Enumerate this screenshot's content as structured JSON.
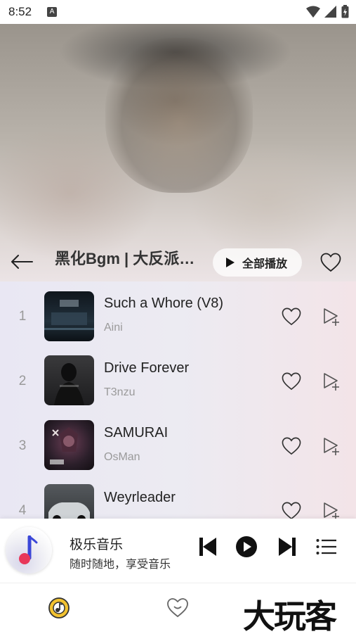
{
  "status_bar": {
    "time": "8:52",
    "notification_icon": "A"
  },
  "header": {
    "title": "黑化Bgm | 大反派…",
    "play_all_label": "全部播放"
  },
  "tracks": [
    {
      "index": "1",
      "title": "Such a Whore (V8)",
      "artist": "Aini",
      "cover_color": "#1a2530"
    },
    {
      "index": "2",
      "title": "Drive Forever",
      "artist": "T3nzu",
      "cover_color": "#2c2c2e"
    },
    {
      "index": "3",
      "title": "SAMURAI",
      "artist": "OsMan",
      "cover_color": "#2b1f2a"
    },
    {
      "index": "4",
      "title": "Weyrleader",
      "artist": "",
      "cover_color": "#3a3d40"
    }
  ],
  "mini_player": {
    "title": "极乐音乐",
    "subtitle": "随时随地，享受音乐"
  },
  "watermark": "大玩客",
  "colors": {
    "accent_nav": "#e8b626",
    "list_bg_left": "#e9e7f3",
    "list_bg_right": "#f3e4e8"
  }
}
